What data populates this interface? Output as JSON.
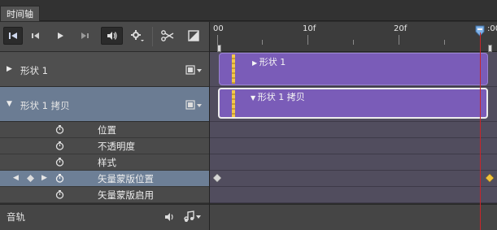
{
  "panel": {
    "tab_label": "时间轴"
  },
  "toolbar": {
    "buttons": [
      {
        "icon": "go-to-first-frame-icon"
      },
      {
        "icon": "previous-frame-icon"
      },
      {
        "icon": "play-icon"
      },
      {
        "icon": "next-frame-icon"
      },
      {
        "icon": "audio-toggle-icon"
      },
      {
        "icon": "settings-gear-icon"
      },
      {
        "icon": "split-scissors-icon"
      },
      {
        "icon": "transition-icon"
      }
    ]
  },
  "ruler": {
    "labels": [
      "00",
      "10f",
      "20f",
      ":00"
    ]
  },
  "layers": [
    {
      "name": "形状 1",
      "expanded": false,
      "clip_label": "形状 1"
    },
    {
      "name": "形状 1 拷贝",
      "expanded": true,
      "clip_label": "形状 1 拷贝"
    }
  ],
  "properties": [
    {
      "name": "位置",
      "selected": false
    },
    {
      "name": "不透明度",
      "selected": false
    },
    {
      "name": "样式",
      "selected": false
    },
    {
      "name": "矢量蒙版位置",
      "selected": true
    },
    {
      "name": "矢量蒙版启用",
      "selected": false
    }
  ],
  "audio": {
    "label": "音轨"
  },
  "colors": {
    "clip": "#7a5cb8",
    "selected_row": "#6d7f96",
    "playhead": "#c8262b",
    "keyframe_active": "#f0c23c"
  }
}
